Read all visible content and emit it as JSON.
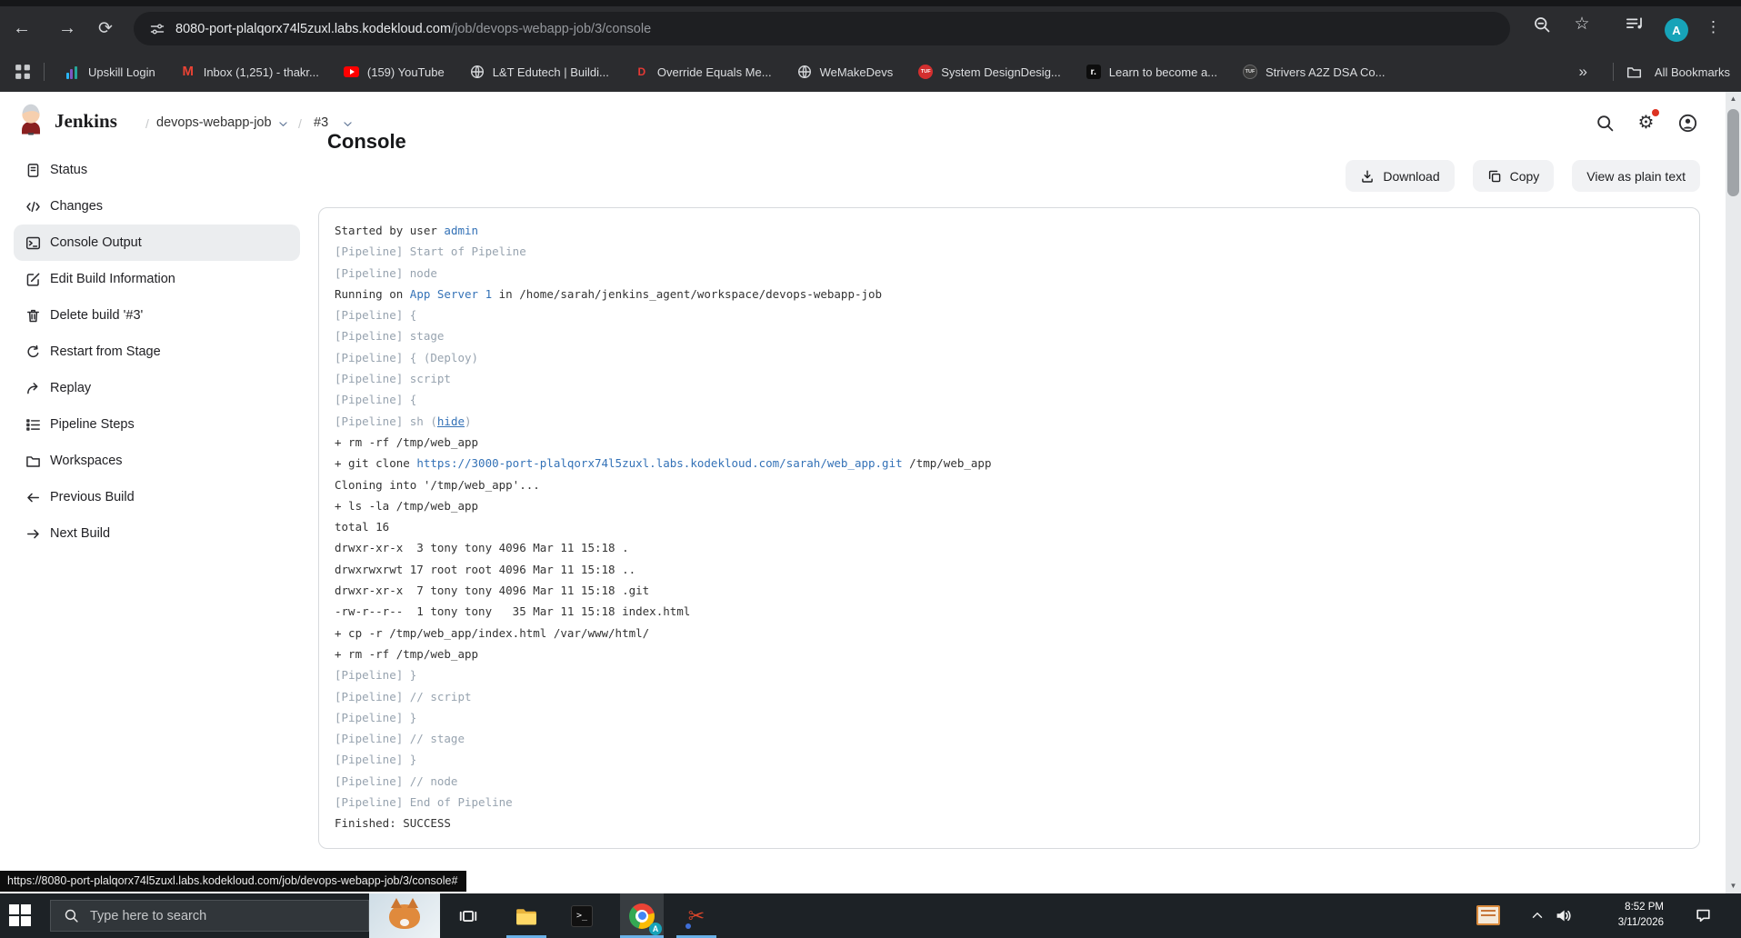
{
  "browser": {
    "url_host": "8080-port-plalqorx74l5zuxl.labs.kodekloud.com",
    "url_path": "/job/devops-webapp-job/3/console",
    "avatar_letter": "A",
    "bookmarks": [
      {
        "icon": "upskill",
        "label": "Upskill Login"
      },
      {
        "icon": "gmail",
        "label": "Inbox (1,251) - thakr..."
      },
      {
        "icon": "youtube",
        "label": "(159) YouTube"
      },
      {
        "icon": "globe",
        "label": "L&T Edutech | Buildi..."
      },
      {
        "icon": "d-red",
        "label": "Override Equals Me..."
      },
      {
        "icon": "globe",
        "label": "WeMakeDevs"
      },
      {
        "icon": "tuf",
        "label": "System DesignDesig..."
      },
      {
        "icon": "roadmap",
        "label": "Learn to become a..."
      },
      {
        "icon": "tuf-dark",
        "label": "Strivers A2Z DSA Co..."
      }
    ],
    "overflow_glyph": "»",
    "all_bookmarks_label": "All Bookmarks"
  },
  "jenkins": {
    "brand": "Jenkins",
    "breadcrumb": {
      "sep1": "/",
      "job": "devops-webapp-job",
      "sep2": "/",
      "build": "#3"
    },
    "page_title": "Console",
    "toolbar": {
      "download": "Download",
      "copy": "Copy",
      "view_plain": "View as plain text"
    },
    "sidebar": [
      {
        "icon": "doc",
        "label": "Status"
      },
      {
        "icon": "code",
        "label": "Changes"
      },
      {
        "icon": "terminal",
        "label": "Console Output",
        "selected": true
      },
      {
        "icon": "edit",
        "label": "Edit Build Information"
      },
      {
        "icon": "trash",
        "label": "Delete build '#3'"
      },
      {
        "icon": "restart",
        "label": "Restart from Stage"
      },
      {
        "icon": "replay",
        "label": "Replay"
      },
      {
        "icon": "steps",
        "label": "Pipeline Steps"
      },
      {
        "icon": "folder",
        "label": "Workspaces"
      },
      {
        "icon": "arrow-left",
        "label": "Previous Build"
      },
      {
        "icon": "arrow-right",
        "label": "Next Build"
      }
    ]
  },
  "console": {
    "lines": [
      [
        [
          "Started by user ",
          "plain"
        ],
        [
          "admin",
          "link"
        ]
      ],
      [
        [
          "[Pipeline] Start of Pipeline",
          "pipe"
        ]
      ],
      [
        [
          "[Pipeline] node",
          "pipe"
        ]
      ],
      [
        [
          "Running on ",
          "plain"
        ],
        [
          "App Server 1",
          "link"
        ],
        [
          " in /home/sarah/jenkins_agent/workspace/devops-webapp-job",
          "plain"
        ]
      ],
      [
        [
          "[Pipeline] {",
          "pipe"
        ]
      ],
      [
        [
          "[Pipeline] stage",
          "pipe"
        ]
      ],
      [
        [
          "[Pipeline] { (Deploy)",
          "pipe"
        ]
      ],
      [
        [
          "[Pipeline] script",
          "pipe"
        ]
      ],
      [
        [
          "[Pipeline] {",
          "pipe"
        ]
      ],
      [
        [
          "[Pipeline] sh (",
          "pipe"
        ],
        [
          "hide",
          "hide"
        ],
        [
          ")",
          "pipe"
        ]
      ],
      [
        [
          "+ rm -rf /tmp/web_app",
          "plain"
        ]
      ],
      [
        [
          "+ git clone ",
          "plain"
        ],
        [
          "https://3000-port-plalqorx74l5zuxl.labs.kodekloud.com/sarah/web_app.git",
          "link"
        ],
        [
          " /tmp/web_app",
          "plain"
        ]
      ],
      [
        [
          "Cloning into '/tmp/web_app'...",
          "plain"
        ]
      ],
      [
        [
          "+ ls -la /tmp/web_app",
          "plain"
        ]
      ],
      [
        [
          "total 16",
          "plain"
        ]
      ],
      [
        [
          "drwxr-xr-x  3 tony tony 4096 Mar 11 15:18 .",
          "plain"
        ]
      ],
      [
        [
          "drwxrwxrwt 17 root root 4096 Mar 11 15:18 ..",
          "plain"
        ]
      ],
      [
        [
          "drwxr-xr-x  7 tony tony 4096 Mar 11 15:18 .git",
          "plain"
        ]
      ],
      [
        [
          "-rw-r--r--  1 tony tony   35 Mar 11 15:18 index.html",
          "plain"
        ]
      ],
      [
        [
          "+ cp -r /tmp/web_app/index.html /var/www/html/",
          "plain"
        ]
      ],
      [
        [
          "+ rm -rf /tmp/web_app",
          "plain"
        ]
      ],
      [
        [
          "[Pipeline] }",
          "pipe"
        ]
      ],
      [
        [
          "[Pipeline] // script",
          "pipe"
        ]
      ],
      [
        [
          "[Pipeline] }",
          "pipe"
        ]
      ],
      [
        [
          "[Pipeline] // stage",
          "pipe"
        ]
      ],
      [
        [
          "[Pipeline] }",
          "pipe"
        ]
      ],
      [
        [
          "[Pipeline] // node",
          "pipe"
        ]
      ],
      [
        [
          "[Pipeline] End of Pipeline",
          "pipe"
        ]
      ],
      [
        [
          "Finished: SUCCESS",
          "plain"
        ]
      ]
    ]
  },
  "statusbar": {
    "url": "https://8080-port-plalqorx74l5zuxl.labs.kodekloud.com/job/devops-webapp-job/3/console#"
  },
  "taskbar": {
    "search_placeholder": "Type here to search",
    "clock_time": "8:52 PM",
    "clock_date": "3/11/2026"
  },
  "colors": {
    "accent_blue": "#3472b7",
    "active_underline": "#6ab1e8",
    "avatar_teal": "#17a3b8",
    "alert_red": "#dd3322"
  }
}
